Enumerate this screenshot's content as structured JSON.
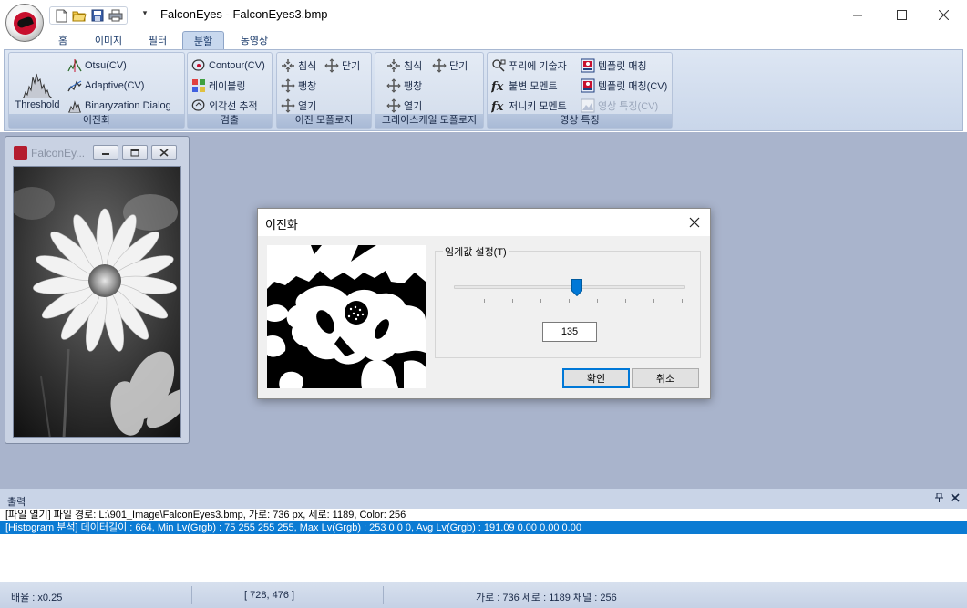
{
  "window": {
    "title": "FalconEyes - FalconEyes3.bmp",
    "controls": [
      "minimize",
      "maximize",
      "close"
    ]
  },
  "quick_access": {
    "buttons": [
      "new-file-icon",
      "open-folder-icon",
      "save-icon",
      "print-icon"
    ],
    "dropdown_glyph": "▾"
  },
  "tabs": [
    {
      "label": "홈"
    },
    {
      "label": "이미지"
    },
    {
      "label": "필터"
    },
    {
      "label": "분할",
      "active": true
    },
    {
      "label": "동영상"
    }
  ],
  "ribbon": {
    "binarization": {
      "label": "이진화",
      "threshold": "Threshold",
      "otsu": "Otsu(CV)",
      "adaptive": "Adaptive(CV)",
      "dialog": "Binaryzation Dialog"
    },
    "detection": {
      "label": "검출",
      "contour": "Contour(CV)",
      "labeling": "레이블링",
      "outline": "외각선 추적"
    },
    "binary_morph": {
      "label": "이진 모폴로지",
      "erode": "침식",
      "close": "닫기",
      "dilate": "팽창",
      "open": "열기"
    },
    "gray_morph": {
      "label": "그레이스케일 모폴로지",
      "erode": "침식",
      "close": "닫기",
      "dilate": "팽창",
      "open": "열기"
    },
    "features": {
      "label": "영상 특징",
      "fourier": "푸리에 기술자",
      "invariant": "불변 모멘트",
      "zernike": "저니키 모멘트",
      "template": "템플릿 매칭",
      "template_cv": "템플릿 매칭(CV)",
      "feature_cv": "영상 특징(CV)"
    }
  },
  "child_window": {
    "title": "FalconEy..."
  },
  "dialog": {
    "title": "이진화",
    "group_label": "임계값 설정(T)",
    "threshold_value": "135",
    "slider_fraction": 0.53,
    "ok": "확인",
    "cancel": "취소"
  },
  "output": {
    "title": "출력",
    "lines": [
      "[파일 열기] 파일 경로: L:\\901_Image\\FalconEyes3.bmp, 가로: 736 px, 세로: 1189, Color: 256",
      "[Histogram 분석] 데이터길이 : 664, Min Lv(Grgb) : 75 255 255 255, Max Lv(Grgb) : 253 0 0 0, Avg Lv(Grgb) : 191.09 0.00 0.00 0.00"
    ]
  },
  "status": {
    "zoom": "배율 : x0.25",
    "coords": "[ 728, 476 ]",
    "dims": "가로 : 736  세로 : 1189  채널 : 256"
  },
  "colors": {
    "ribbon_bg": "#c9d6ea",
    "mdi_bg": "#a9b4cc",
    "selection": "#0b7bd3",
    "accent": "#0078d7"
  }
}
